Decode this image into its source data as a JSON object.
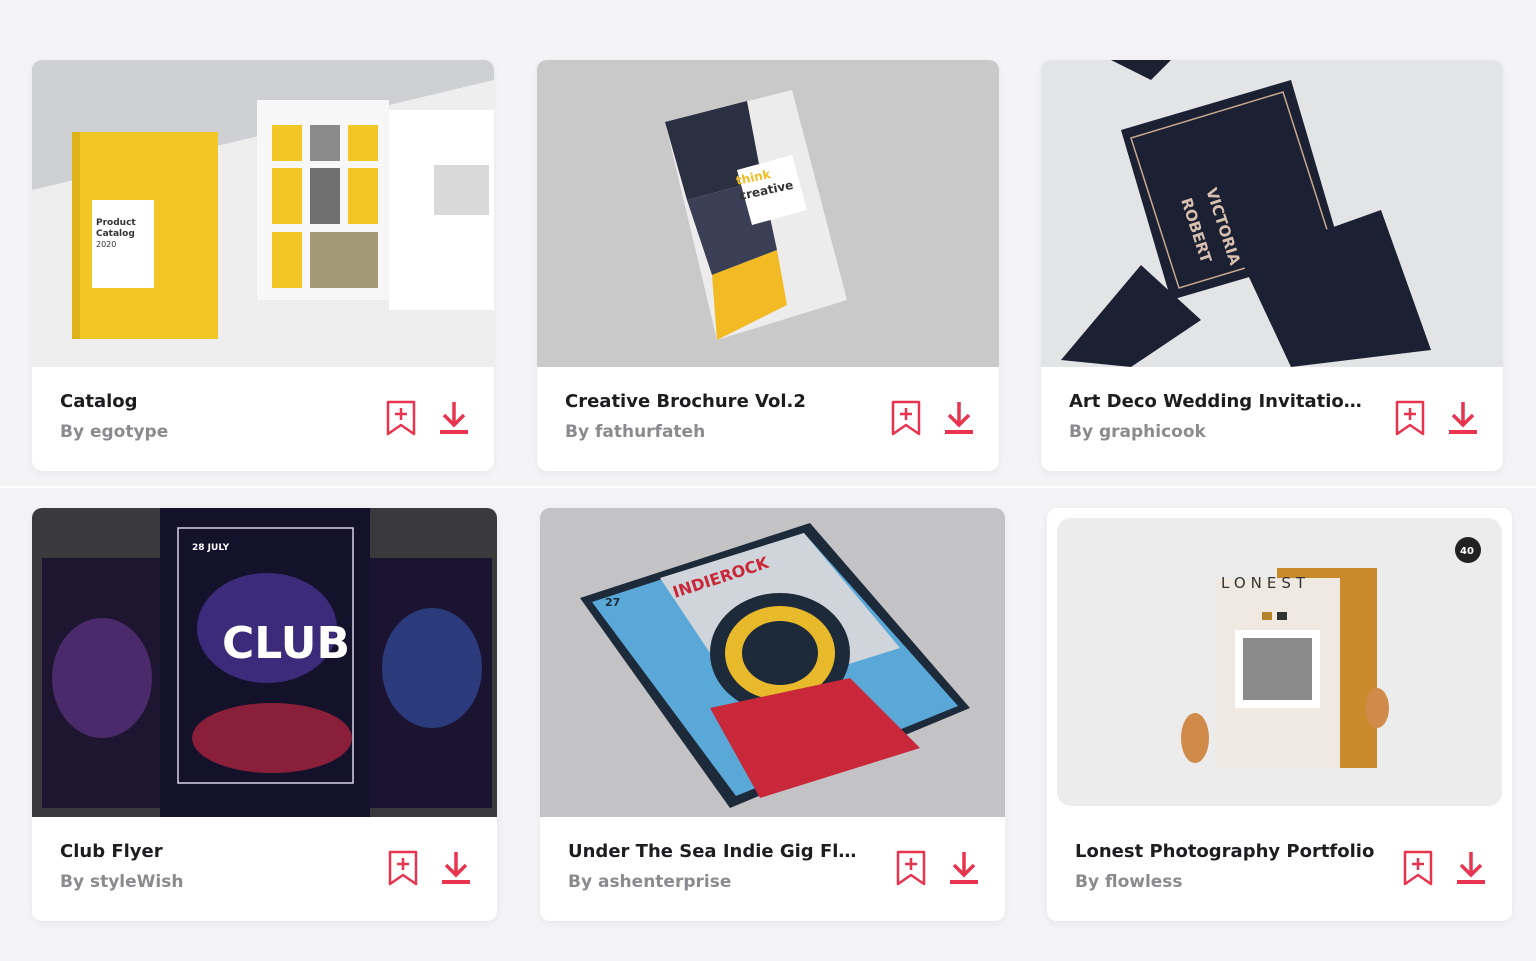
{
  "accent_color": "#e8344f",
  "cards": [
    {
      "title": "Catalog",
      "by": "By",
      "author": "egotype",
      "thumb_text": [
        "Product",
        "Catalog",
        "2020"
      ]
    },
    {
      "title": "Creative Brochure Vol.2",
      "by": "By",
      "author": "fathurfateh",
      "thumb_text": [
        "think",
        "creative"
      ]
    },
    {
      "title": "Art Deco Wedding Invitation...",
      "by": "By",
      "author": "graphicook",
      "thumb_text": [
        "VICTORIA",
        "ROBERT"
      ]
    },
    {
      "title": "Club Flyer",
      "by": "By",
      "author": "styleWish",
      "thumb_text": [
        "28 JULY",
        "CLUB"
      ]
    },
    {
      "title": "Under The Sea Indie Gig Flyer",
      "by": "By",
      "author": "ashenterprise",
      "thumb_text": [
        "INDIEROCK",
        "27"
      ]
    },
    {
      "title": "Lonest Photography Portfolio",
      "by": "By",
      "author": "flowless",
      "thumb_text": [
        "LONEST",
        "40"
      ]
    }
  ],
  "icons": {
    "bookmark": "bookmark-add-icon",
    "download": "download-icon"
  }
}
